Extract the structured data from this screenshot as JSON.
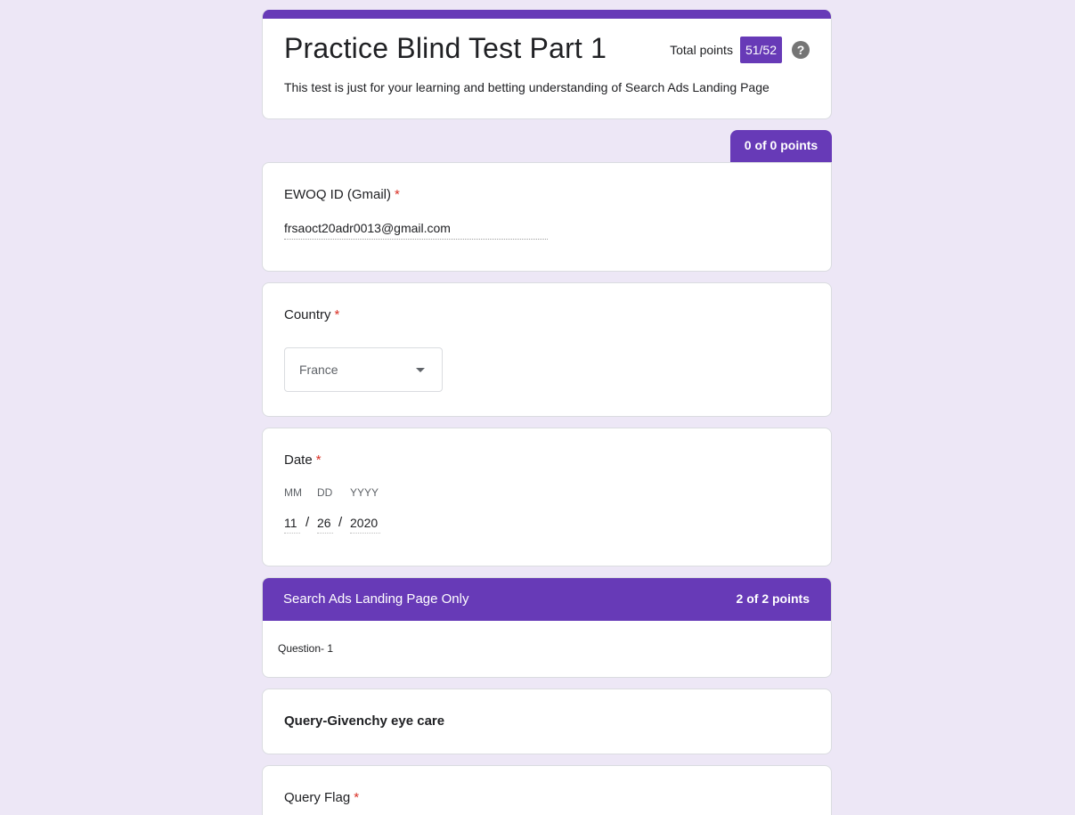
{
  "form": {
    "title": "Practice Blind Test Part 1",
    "description": "This test is just for your learning and betting understanding of Search Ads Landing Page",
    "total_points_label": "Total points",
    "total_points_value": "51/52",
    "help_glyph": "?"
  },
  "first_section": {
    "points": "0 of 0 points"
  },
  "questions": {
    "email": {
      "label": "EWOQ ID (Gmail)",
      "required_mark": "*",
      "value": "frsaoct20adr0013@gmail.com"
    },
    "country": {
      "label": "Country",
      "required_mark": "*",
      "selected": "France"
    },
    "date": {
      "label": "Date",
      "required_mark": "*",
      "mm_label": "MM",
      "dd_label": "DD",
      "yyyy_label": "YYYY",
      "mm": "11",
      "dd": "26",
      "yyyy": "2020",
      "separator": "/"
    },
    "query": {
      "text": "Query-Givenchy eye care"
    },
    "query_flag": {
      "label": "Query Flag",
      "required_mark": "*"
    }
  },
  "section2": {
    "title": "Search Ads Landing Page Only",
    "points": "2 of 2 points",
    "description": "Question- 1"
  },
  "colors": {
    "accent": "#673ab7",
    "background": "#ede7f6",
    "required": "#d93025"
  },
  "icons": {
    "help": "help-circle-icon",
    "dropdown": "caret-down-icon"
  }
}
